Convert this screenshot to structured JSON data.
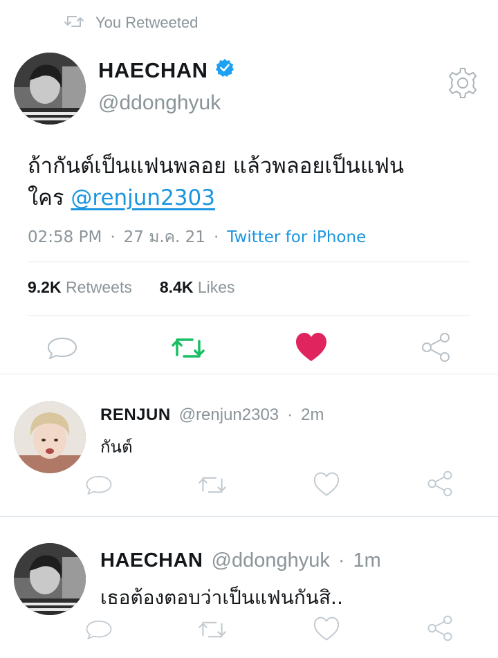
{
  "retweet_header": {
    "label": "You Retweeted",
    "icon": "retweet-icon"
  },
  "main_tweet": {
    "name": "HAECHAN",
    "handle": "@ddonghyuk",
    "verified": true,
    "text": "ถ้ากันต์เป็นแฟนพลอย แล้วพลอยเป็นแฟน",
    "text_line2_prefix": "ใคร ",
    "mention": "@renjun2303",
    "time": "02:58 PM",
    "sep1": "·",
    "date": "27 ม.ค. 21",
    "sep2": "·",
    "source": "Twitter for iPhone",
    "retweets_count": "9.2K",
    "retweets_label": "Retweets",
    "likes_count": "8.4K",
    "likes_label": "Likes",
    "retweeted": true,
    "liked": true
  },
  "replies": [
    {
      "name": "RENJUN",
      "handle": "@renjun2303",
      "sep": "·",
      "time": "2m",
      "text": "กันต์"
    },
    {
      "name": "HAECHAN",
      "handle": "@ddonghyuk",
      "sep": "·",
      "time": "1m",
      "text": "เธอต้องตอบว่าเป็นแฟนกันสิ.."
    }
  ],
  "colors": {
    "accent": "#1b95e0",
    "retweet_active": "#17bf63",
    "like_active": "#e0245e",
    "muted": "#8a9499",
    "divider": "#e1e8ed"
  }
}
